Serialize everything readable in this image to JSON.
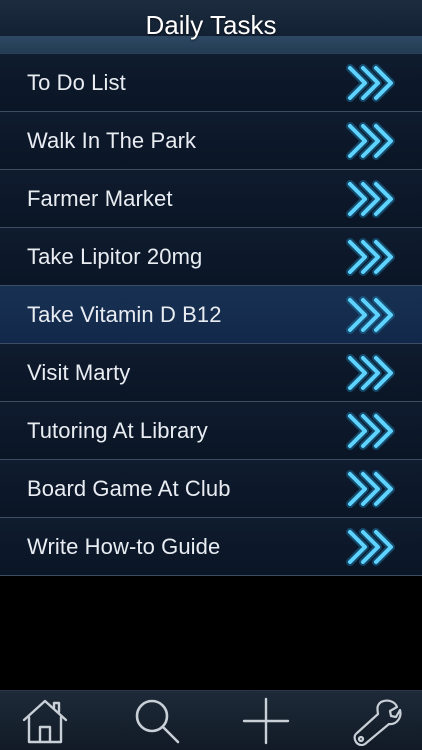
{
  "header": {
    "title": "Daily Tasks"
  },
  "tasks": [
    {
      "label": "To Do List"
    },
    {
      "label": "Walk In The Park"
    },
    {
      "label": "Farmer Market"
    },
    {
      "label": "Take Lipitor 20mg"
    },
    {
      "label": "Take Vitamin D B12"
    },
    {
      "label": "Visit Marty"
    },
    {
      "label": "Tutoring At Library"
    },
    {
      "label": "Board Game At Club"
    },
    {
      "label": "Write How-to Guide"
    }
  ],
  "selected_task_index": 4,
  "tabbar": {
    "items": [
      {
        "icon": "home-icon"
      },
      {
        "icon": "search-icon"
      },
      {
        "icon": "add-icon"
      },
      {
        "icon": "wrench-icon"
      }
    ]
  },
  "colors": {
    "header_bg": "#142235",
    "row_bg": "#0f1c2f",
    "row_selected_bg": "#183152",
    "row_text": "#e9edf2",
    "chevron": "#5fd3ff",
    "tab_icon": "#c9cfd6"
  }
}
